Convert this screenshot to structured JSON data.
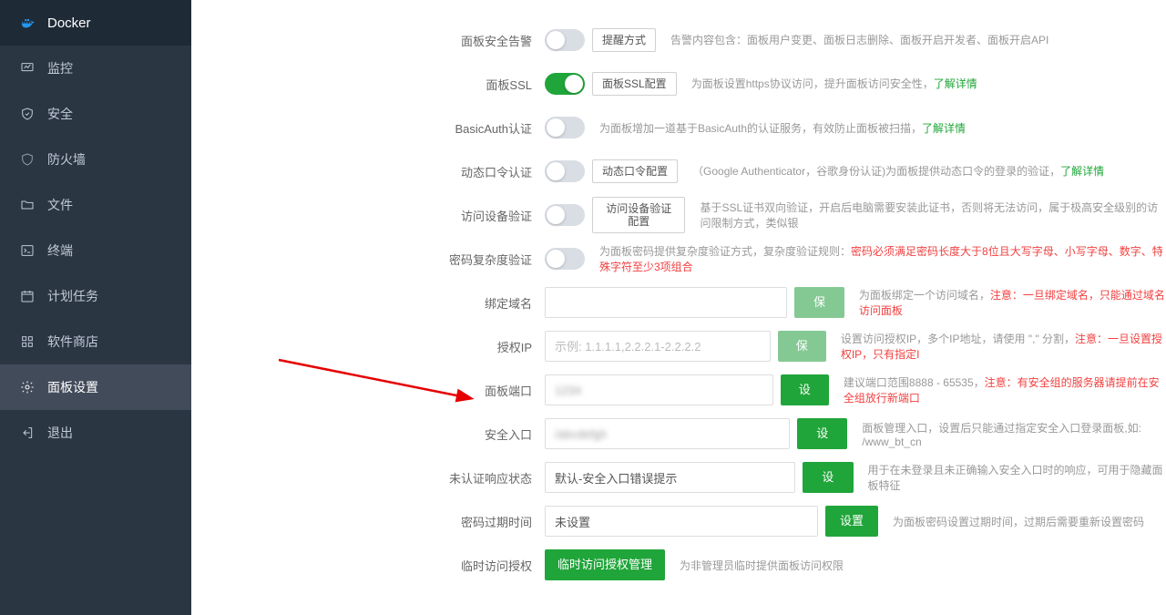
{
  "sidebar": {
    "items": [
      {
        "label": "Docker",
        "icon": "docker"
      },
      {
        "label": "监控",
        "icon": "monitor"
      },
      {
        "label": "安全",
        "icon": "shield"
      },
      {
        "label": "防火墙",
        "icon": "firewall"
      },
      {
        "label": "文件",
        "icon": "folder"
      },
      {
        "label": "终端",
        "icon": "terminal"
      },
      {
        "label": "计划任务",
        "icon": "calendar"
      },
      {
        "label": "软件商店",
        "icon": "apps"
      },
      {
        "label": "面板设置",
        "icon": "gear"
      },
      {
        "label": "退出",
        "icon": "logout"
      }
    ]
  },
  "rows": {
    "alert": {
      "label": "面板安全告警",
      "btn": "提醒方式",
      "desc": "告警内容包含：面板用户变更、面板日志删除、面板开启开发者、面板开启API"
    },
    "ssl": {
      "label": "面板SSL",
      "btn": "面板SSL配置",
      "desc": "为面板设置https协议访问，提升面板访问安全性，",
      "link": "了解详情"
    },
    "basic": {
      "label": "BasicAuth认证",
      "desc": "为面板增加一道基于BasicAuth的认证服务，有效防止面板被扫描，",
      "link": "了解详情"
    },
    "otp": {
      "label": "动态口令认证",
      "btn": "动态口令配置",
      "desc": "（Google Authenticator，谷歌身份认证)为面板提供动态口令的登录的验证，",
      "link": "了解详情"
    },
    "device": {
      "label": "访问设备验证",
      "btn": "访问设备验证配置",
      "desc": "基于SSL证书双向验证，开启后电脑需要安装此证书，否则将无法访问，属于极高安全级别的访问限制方式，类似银"
    },
    "pwdcomplex": {
      "label": "密码复杂度验证",
      "desc": "为面板密码提供复杂度验证方式，复杂度验证规则：",
      "red": "密码必须满足密码长度大于8位且大写字母、小写字母、数字、特殊字符至少3项组合"
    },
    "domain": {
      "label": "绑定域名",
      "btn": "保存",
      "desc": "为面板绑定一个访问域名，",
      "red": "注意：一旦绑定域名，只能通过域名访问面板"
    },
    "ip": {
      "label": "授权IP",
      "placeholder": "示例: 1.1.1.1,2.2.2.1-2.2.2.2",
      "btn": "保存",
      "desc": "设置访问授权IP，多个IP地址，请使用 \",\" 分割，",
      "red": "注意：一旦设置授权IP，只有指定I"
    },
    "port": {
      "label": "面板端口",
      "value": "",
      "btn": "设置",
      "desc": "建议端口范围8888 - 65535，",
      "red": "注意：有安全组的服务器请提前在安全组放行新端口"
    },
    "entry": {
      "label": "安全入口",
      "value": "",
      "btn": "设置",
      "desc": "面板管理入口，设置后只能通过指定安全入口登录面板,如: /www_bt_cn"
    },
    "unauth": {
      "label": "未认证响应状态",
      "value": "默认-安全入口错误提示",
      "btn": "设置",
      "desc": "用于在未登录且未正确输入安全入口时的响应，可用于隐藏面板特征"
    },
    "expire": {
      "label": "密码过期时间",
      "value": "未设置",
      "btn": "设置",
      "desc": "为面板密码设置过期时间，过期后需要重新设置密码"
    },
    "temp": {
      "label": "临时访问授权",
      "btn": "临时访问授权管理",
      "desc": "为非管理员临时提供面板访问权限"
    }
  }
}
